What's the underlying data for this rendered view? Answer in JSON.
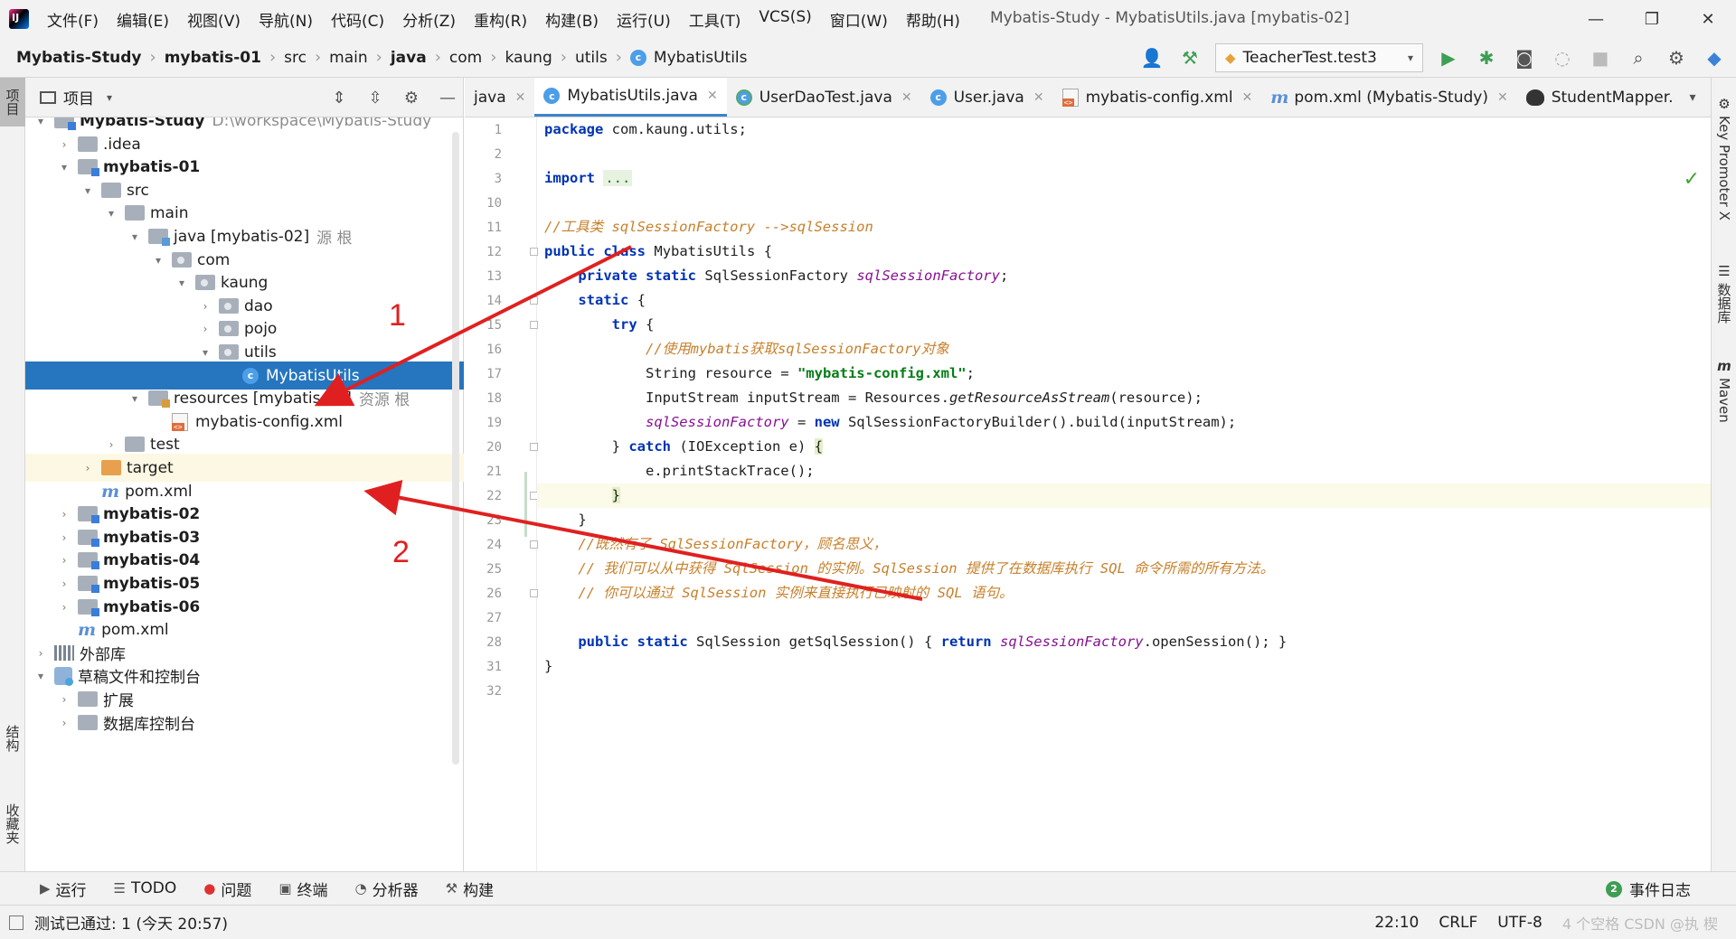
{
  "window": {
    "title": "Mybatis-Study - MybatisUtils.java [mybatis-02]",
    "minimize": "—",
    "maximize": "❐",
    "close": "✕"
  },
  "menu": [
    "文件(F)",
    "编辑(E)",
    "视图(V)",
    "导航(N)",
    "代码(C)",
    "分析(Z)",
    "重构(R)",
    "构建(B)",
    "运行(U)",
    "工具(T)",
    "VCS(S)",
    "窗口(W)",
    "帮助(H)"
  ],
  "breadcrumb": {
    "items": [
      "Mybatis-Study",
      "mybatis-01",
      "src",
      "main",
      "java",
      "com",
      "kaung",
      "utils",
      "MybatisUtils"
    ],
    "bold": [
      true,
      true,
      false,
      false,
      true,
      false,
      false,
      false,
      false
    ]
  },
  "toolbar": {
    "run_config": "TeacherTest.test3",
    "icons": [
      "user-icon",
      "build-hammer-icon",
      "run-icon",
      "debug-icon",
      "coverage-icon",
      "profile-icon",
      "stop-icon",
      "search-icon",
      "settings-icon",
      "toolbox-icon"
    ]
  },
  "left_strip": {
    "project": "项目",
    "structure": "结构",
    "favorites": "收藏夹"
  },
  "right_strip": {
    "key_promoter": "Key Promoter X",
    "database": "数据库",
    "maven": "Maven"
  },
  "project_panel": {
    "title": "项目",
    "tree": [
      {
        "label": "Mybatis-Study",
        "extra": "D:\\workspace\\Mybatis-Study",
        "bold": true,
        "arrow": "▾",
        "icon": "module-folder"
      },
      {
        "label": ".idea",
        "extra": "",
        "bold": false,
        "arrow": "›",
        "icon": "folder"
      },
      {
        "label": "mybatis-01",
        "extra": "",
        "bold": true,
        "arrow": "▾",
        "icon": "module-folder"
      },
      {
        "label": "src",
        "extra": "",
        "bold": false,
        "arrow": "▾",
        "icon": "folder"
      },
      {
        "label": "main",
        "extra": "",
        "bold": false,
        "arrow": "▾",
        "icon": "folder"
      },
      {
        "label": "java [mybatis-02]",
        "extra": "源 根",
        "bold": false,
        "arrow": "▾",
        "icon": "source-folder"
      },
      {
        "label": "com",
        "extra": "",
        "bold": false,
        "arrow": "▾",
        "icon": "package"
      },
      {
        "label": "kaung",
        "extra": "",
        "bold": false,
        "arrow": "▾",
        "icon": "package"
      },
      {
        "label": "dao",
        "extra": "",
        "bold": false,
        "arrow": "›",
        "icon": "package"
      },
      {
        "label": "pojo",
        "extra": "",
        "bold": false,
        "arrow": "›",
        "icon": "package"
      },
      {
        "label": "utils",
        "extra": "",
        "bold": false,
        "arrow": "▾",
        "icon": "package"
      },
      {
        "label": "MybatisUtils",
        "extra": "",
        "bold": false,
        "arrow": "",
        "icon": "class",
        "selected": true
      },
      {
        "label": "resources [mybatis-02]",
        "extra": "资源 根",
        "bold": false,
        "arrow": "▾",
        "icon": "resource-folder"
      },
      {
        "label": "mybatis-config.xml",
        "extra": "",
        "bold": false,
        "arrow": "",
        "icon": "xml"
      },
      {
        "label": "test",
        "extra": "",
        "bold": false,
        "arrow": "›",
        "icon": "folder"
      },
      {
        "label": "target",
        "extra": "",
        "bold": false,
        "arrow": "›",
        "icon": "excluded-folder",
        "highlight": true
      },
      {
        "label": "pom.xml",
        "extra": "",
        "bold": false,
        "arrow": "",
        "icon": "maven"
      },
      {
        "label": "mybatis-02",
        "extra": "",
        "bold": true,
        "arrow": "›",
        "icon": "module-folder"
      },
      {
        "label": "mybatis-03",
        "extra": "",
        "bold": true,
        "arrow": "›",
        "icon": "module-folder"
      },
      {
        "label": "mybatis-04",
        "extra": "",
        "bold": true,
        "arrow": "›",
        "icon": "module-folder"
      },
      {
        "label": "mybatis-05",
        "extra": "",
        "bold": true,
        "arrow": "›",
        "icon": "module-folder"
      },
      {
        "label": "mybatis-06",
        "extra": "",
        "bold": true,
        "arrow": "›",
        "icon": "module-folder"
      },
      {
        "label": "pom.xml",
        "extra": "",
        "bold": false,
        "arrow": "",
        "icon": "maven"
      },
      {
        "label": "外部库",
        "extra": "",
        "bold": false,
        "arrow": "›",
        "icon": "library"
      },
      {
        "label": "草稿文件和控制台",
        "extra": "",
        "bold": false,
        "arrow": "▾",
        "icon": "scratch"
      },
      {
        "label": "扩展",
        "extra": "",
        "bold": false,
        "arrow": "›",
        "icon": "folder"
      },
      {
        "label": "数据库控制台",
        "extra": "",
        "bold": false,
        "arrow": "›",
        "icon": "folder"
      }
    ]
  },
  "editor": {
    "tabs": [
      {
        "label": "java",
        "icon": "none",
        "active": false
      },
      {
        "label": "MybatisUtils.java",
        "icon": "class",
        "active": true
      },
      {
        "label": "UserDaoTest.java",
        "icon": "test",
        "active": false
      },
      {
        "label": "User.java",
        "icon": "class",
        "active": false
      },
      {
        "label": "mybatis-config.xml",
        "icon": "xml",
        "active": false
      },
      {
        "label": "pom.xml (Mybatis-Study)",
        "icon": "maven",
        "active": false
      },
      {
        "label": "StudentMapper.",
        "icon": "mapper",
        "active": false
      }
    ],
    "line_numbers": [
      "1",
      "2",
      "3",
      "10",
      "11",
      "12",
      "13",
      "14",
      "15",
      "16",
      "17",
      "18",
      "19",
      "20",
      "21",
      "22",
      "23",
      "24",
      "25",
      "26",
      "27",
      "28",
      "31",
      "32"
    ],
    "code": {
      "l1_kw": "package",
      "l1_rest": " com.kaung.utils;",
      "l3_kw": "import",
      "l3_dots": "...",
      "l11_cm": "//工具类 sqlSessionFactory -->sqlSession",
      "l12_kw1": "public",
      "l12_kw2": "class",
      "l12_name": "MybatisUtils",
      "l12_brace": "{",
      "l13_kw1": "private",
      "l13_kw2": "static",
      "l13_type": "SqlSessionFactory",
      "l13_fld": "sqlSessionFactory",
      "l14_kw": "static",
      "l15_kw": "try",
      "l16_cm": "//使用mybatis获取sqlSessionFactory对象",
      "l17_type": "String resource = ",
      "l17_str": "\"mybatis-config.xml\"",
      "l18_pre": "InputStream inputStream = Resources.",
      "l18_meth": "getResourceAsStream",
      "l18_post": "(resource);",
      "l19_fld": "sqlSessionFactory",
      "l19_mid": " = ",
      "l19_kw": "new",
      "l19_post": " SqlSessionFactoryBuilder().build(inputStream);",
      "l20_pre": "} ",
      "l20_kw": "catch",
      "l20_post": " (IOException e) ",
      "l21": "e.printStackTrace();",
      "l24_cm": "//既然有了 SqlSessionFactory，顾名思义，",
      "l25_cm": "// 我们可以从中获得 SqlSession 的实例。SqlSession 提供了在数据库执行 SQL 命令所需的所有方法。",
      "l26_cm": "// 你可以通过 SqlSession 实例来直接执行已映射的 SQL 语句。",
      "l28_kw1": "public",
      "l28_kw2": "static",
      "l28_mid": " SqlSession getSqlSession() { ",
      "l28_kw3": "return",
      "l28_fld": "sqlSessionFactory",
      "l28_post": ".openSession(); }",
      "l31": "}"
    }
  },
  "annotations": {
    "one": "1",
    "two": "2",
    "arrow_color": "#e02020"
  },
  "bottom_tools": [
    {
      "label": "运行",
      "icon": "▶"
    },
    {
      "label": "TODO",
      "icon": "☰"
    },
    {
      "label": "问题",
      "icon": "●"
    },
    {
      "label": "终端",
      "icon": "▣"
    },
    {
      "label": "分析器",
      "icon": "◔"
    },
    {
      "label": "构建",
      "icon": "⚒"
    }
  ],
  "event_log": {
    "badge": "2",
    "label": "事件日志"
  },
  "status": {
    "message": "测试已通过: 1 (今天 20:57)",
    "position": "22:10",
    "line_sep": "CRLF",
    "encoding": "UTF-8",
    "indent": "4 个空格",
    "watermark": "CSDN @执 楔"
  },
  "colors": {
    "selection": "#2675bf",
    "keyword": "#0033b3",
    "comment": "#c7802b",
    "string": "#067d17",
    "field": "#871094"
  }
}
